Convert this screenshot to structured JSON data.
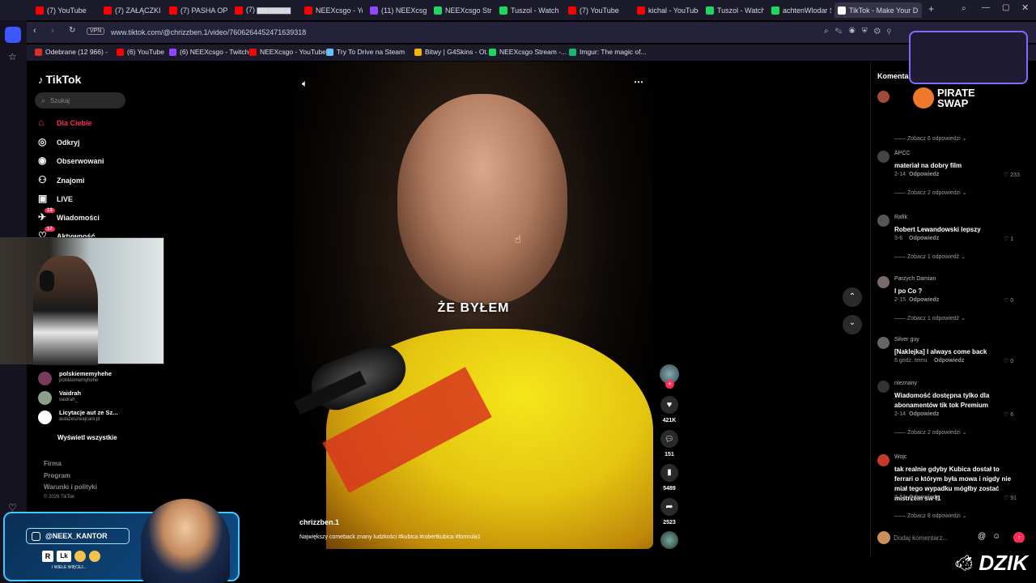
{
  "browser": {
    "tabs": [
      {
        "label": "(7) YouTube",
        "color": "#ff0000"
      },
      {
        "label": "(7) ZAŁĄCZKI POD",
        "color": "#ff0000"
      },
      {
        "label": "(7) PASHA OPIEP",
        "color": "#ff0000"
      },
      {
        "label": "(7) ▆▆▆▆▆▆",
        "color": "#ff0000"
      },
      {
        "label": "NEEXcsgo - You",
        "color": "#ff0000"
      },
      {
        "label": "(11) NEEXcsgo -",
        "color": "#9146ff"
      },
      {
        "label": "NEEXcsgo Stream",
        "color": "#1ed760"
      },
      {
        "label": "Tuszol - Watch c",
        "color": "#1ed760"
      },
      {
        "label": "(7) YouTube",
        "color": "#ff0000"
      },
      {
        "label": "kichal - YouTube",
        "color": "#ff0000"
      },
      {
        "label": "Tuszol - Watch c",
        "color": "#1ed760"
      },
      {
        "label": "achtenWlodar St",
        "color": "#1ed760"
      },
      {
        "label": "TikTok - Make Your D",
        "color": "#ffffff"
      }
    ],
    "url": "www.tiktok.com/@chrizzben.1/video/7606264452471639318",
    "vpn_label": "VPN",
    "bookmarks": [
      {
        "label": "Odebrane (12 966) -",
        "color": "#d93025"
      },
      {
        "label": "(6) YouTube",
        "color": "#ff0000"
      },
      {
        "label": "(6) NEEXcsgo - Twitch",
        "color": "#9146ff"
      },
      {
        "label": "NEEXcsgo - YouTube",
        "color": "#ff0000"
      },
      {
        "label": "Try To Drive na Steam",
        "color": "#66c0f4"
      },
      {
        "label": "Bitwy | G4Skins - Ot...",
        "color": "#f4b400"
      },
      {
        "label": "NEEXcsgo Stream -...",
        "color": "#1ed760"
      },
      {
        "label": "Imgur: The magic of...",
        "color": "#1bb76e"
      }
    ]
  },
  "tiktok": {
    "logo": "TikTok",
    "search_placeholder": "Szukaj",
    "nav": [
      {
        "label": "Dla Ciebie",
        "icon": "home-icon",
        "active": true
      },
      {
        "label": "Odkryj",
        "icon": "compass-icon"
      },
      {
        "label": "Obserwowani",
        "icon": "following-icon"
      },
      {
        "label": "Znajomi",
        "icon": "friends-icon"
      },
      {
        "label": "LIVE",
        "icon": "live-icon"
      },
      {
        "label": "Wiadomości",
        "icon": "inbox-icon",
        "badge": "13"
      },
      {
        "label": "Aktywność",
        "icon": "activity-icon",
        "badge": "17"
      }
    ],
    "following": [
      {
        "name": "polskiememyhehe",
        "handle": "polskiememyhehe"
      },
      {
        "name": "Vaidrah",
        "handle": "vaidrah_"
      },
      {
        "name": "Licytacje aut ze Sz...",
        "handle": "autazeszwajcarii.pl"
      }
    ],
    "show_all": "Wyświetl wszystkie",
    "footer": [
      "Firma",
      "Program",
      "Warunki i polityki",
      "© 2026 TikTok"
    ],
    "video": {
      "caption_overlay": "ŻE BYŁEM",
      "author": "chrizzben.1",
      "description": "Największy comeback znany ludzkości #kubica #robertkubica #formula1",
      "likes": "421K",
      "comments": "151",
      "saves": "5489",
      "shares": "2523"
    },
    "comments_title": "Komentarze",
    "comments": [
      {
        "user": "",
        "text": "",
        "date": "",
        "reply": "",
        "likes": "",
        "replies": "Zobacz 6 odpowiedzi"
      },
      {
        "user": "APCC",
        "text": "materiał na dobry film",
        "date": "2-14",
        "reply": "Odpowiedz",
        "likes": "233",
        "replies": "Zobacz 2 odpowiedzi"
      },
      {
        "user": "Rafik",
        "text": "Robert Lewandowski lepszy",
        "date": "3-6",
        "reply": "Odpowiedz",
        "likes": "1",
        "replies": "Zobacz 1 odpowiedź"
      },
      {
        "user": "Parzych Damian",
        "text": "I po Co ?",
        "date": "2-15",
        "reply": "Odpowiedz",
        "likes": "0",
        "replies": "Zobacz 1 odpowiedź"
      },
      {
        "user": "Silver guy",
        "text": "[Naklejka] I always come back",
        "date": "6 godz. temu",
        "reply": "Odpowiedz",
        "likes": "0",
        "replies": ""
      },
      {
        "user": "nieznany",
        "text": "Wiadomość dostępna tylko dla abonamentów tik tok Premium",
        "date": "2-14",
        "reply": "Odpowiedz",
        "likes": "6",
        "replies": "Zobacz 2 odpowiedzi"
      },
      {
        "user": "Wojc",
        "text": "tak realnie gdyby Kubica dostał to ferrari o którym była mowa i nigdy nie miał tego wypadku mógłby zostać mistrzem sw f1",
        "date": "2-13",
        "reply": "Odpowiedz",
        "likes": "91",
        "replies": "Zobacz 8 odpowiedzi"
      }
    ],
    "comment_placeholder": "Dodaj komentarz..."
  },
  "overlays": {
    "instagram": "@NEEX_KANTOR",
    "more": "I WIELE WIĘCEJ...",
    "piratswap_line1": "PIRATE",
    "piratswap_line2": "SWAP",
    "dzik": "DZIK"
  }
}
